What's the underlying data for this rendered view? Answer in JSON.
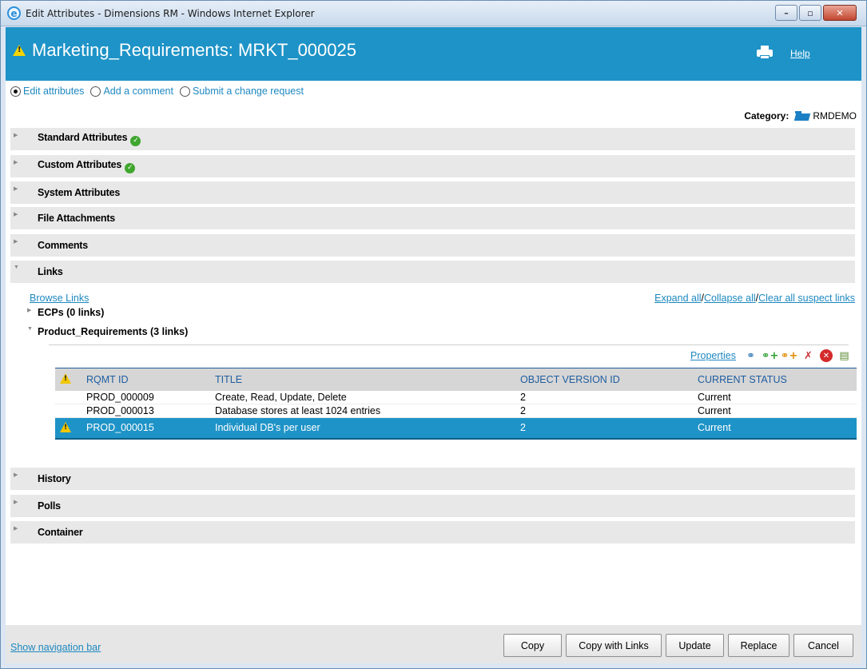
{
  "window": {
    "title": "Edit Attributes - Dimensions RM - Windows Internet Explorer",
    "app_icon": "ie-icon",
    "controls": [
      "minimize",
      "maximize",
      "close"
    ]
  },
  "header": {
    "title": "Marketing_Requirements: MRKT_000025",
    "help_label": "Help",
    "accent_color": "#1e93c7"
  },
  "mode_options": [
    {
      "label": "Edit attributes",
      "selected": true
    },
    {
      "label": "Add a comment",
      "selected": false
    },
    {
      "label": "Submit a change request",
      "selected": false
    }
  ],
  "category": {
    "label": "Category:",
    "value": "RMDEMO"
  },
  "sections": {
    "standard": {
      "label": "Standard Attributes",
      "expanded": false,
      "valid": true
    },
    "custom": {
      "label": "Custom Attributes",
      "expanded": false,
      "valid": true
    },
    "system": {
      "label": "System Attributes",
      "expanded": false
    },
    "files": {
      "label": "File Attachments",
      "expanded": false
    },
    "comments": {
      "label": "Comments",
      "expanded": false
    },
    "links": {
      "label": "Links",
      "expanded": true
    },
    "history": {
      "label": "History",
      "expanded": false
    },
    "polls": {
      "label": "Polls",
      "expanded": false
    },
    "container": {
      "label": "Container",
      "expanded": false
    }
  },
  "links": {
    "browse_label": "Browse Links",
    "expand_all": "Expand all",
    "collapse_all": "Collapse all",
    "clear_suspect": "Clear all suspect links",
    "sep": "/",
    "groups": [
      {
        "label": "ECPs (0 links)",
        "expanded": false
      },
      {
        "label": "Product_Requirements (3 links)",
        "expanded": true
      }
    ],
    "properties_label": "Properties",
    "toolbar_icons": [
      "link-icon",
      "add-link-icon",
      "add-link-alt-icon",
      "remove-link-icon",
      "delete-icon",
      "notepad-icon"
    ],
    "table": {
      "columns": [
        "RQMT ID",
        "TITLE",
        "OBJECT VERSION ID",
        "CURRENT STATUS"
      ],
      "rows": [
        {
          "id": "PROD_000009",
          "title": "Create, Read, Update, Delete",
          "version": "2",
          "status": "Current",
          "suspect": false,
          "selected": false
        },
        {
          "id": "PROD_000013",
          "title": "Database stores at least 1024 entries",
          "version": "2",
          "status": "Current",
          "suspect": false,
          "selected": false
        },
        {
          "id": "PROD_000015",
          "title": "Individual DB's per user",
          "version": "2",
          "status": "Current",
          "suspect": true,
          "selected": true
        }
      ]
    }
  },
  "footer": {
    "nav_label": "Show navigation bar",
    "buttons": {
      "copy": "Copy",
      "copy_links": "Copy with Links",
      "update": "Update",
      "replace": "Replace",
      "cancel": "Cancel"
    }
  }
}
